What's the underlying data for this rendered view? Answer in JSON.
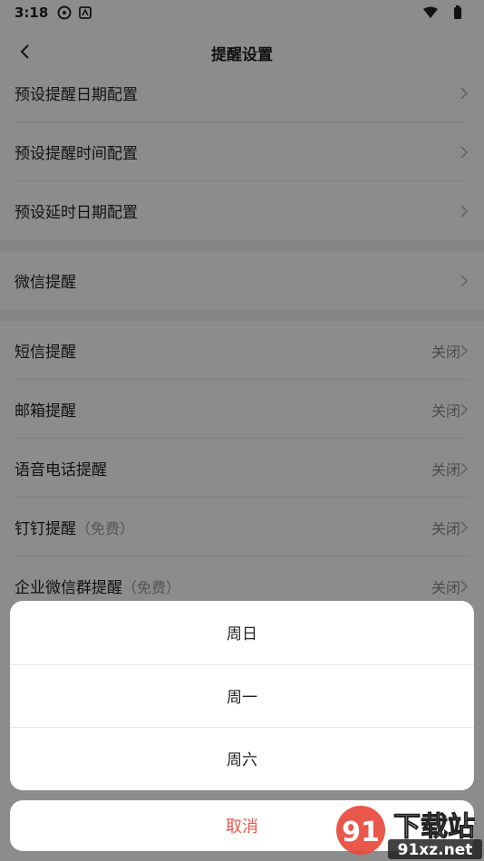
{
  "status_bar": {
    "time": "3:18"
  },
  "header": {
    "title": "提醒设置"
  },
  "list": [
    {
      "label": "预设提醒日期配置",
      "value": ""
    },
    {
      "label": "预设提醒时间配置",
      "value": ""
    },
    {
      "label": "预设延时日期配置",
      "value": ""
    },
    {
      "label": "微信提醒",
      "value": ""
    },
    {
      "label": "短信提醒",
      "value": "关闭"
    },
    {
      "label": "邮箱提醒",
      "value": "关闭"
    },
    {
      "label": "语音电话提醒",
      "value": "关闭"
    },
    {
      "label": "钉钉提醒",
      "note": "（免费）",
      "value": "关闭"
    },
    {
      "label": "企业微信群提醒",
      "note": "（免费）",
      "value": "关闭"
    }
  ],
  "sheet": {
    "options": [
      "周日",
      "周一",
      "周六"
    ],
    "cancel": "取消"
  },
  "watermark": {
    "text": "91xz.net",
    "brand": "下载站"
  },
  "colors": {
    "accent": "#e65a4f",
    "overlay": "rgba(0,0,0,0.45)"
  }
}
